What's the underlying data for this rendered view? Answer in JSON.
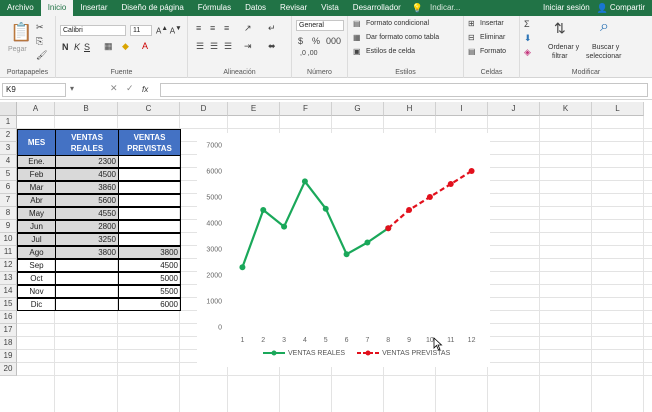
{
  "ribbon": {
    "tabs": [
      "Archivo",
      "Inicio",
      "Insertar",
      "Diseño de página",
      "Fórmulas",
      "Datos",
      "Revisar",
      "Vista",
      "Desarrollador"
    ],
    "active_tab": "Inicio",
    "tell_me": "Indicar...",
    "signin": "Iniciar sesión",
    "share": "Compartir",
    "paste": "Pegar",
    "font_name": "Calibri",
    "font_size": "11",
    "number_format": "General",
    "cond_format": "Formato condicional",
    "table_format": "Dar formato como tabla",
    "cell_styles": "Estilos de celda",
    "insert": "Insertar",
    "delete": "Eliminar",
    "format": "Formato",
    "sort_filter": [
      "Ordenar y",
      "filtrar"
    ],
    "find_select": [
      "Buscar y",
      "seleccionar"
    ],
    "groups": [
      "Portapapeles",
      "Fuente",
      "Alineación",
      "Número",
      "Estilos",
      "Celdas",
      "Modificar"
    ],
    "font_buttons": [
      "N",
      "K",
      "S"
    ]
  },
  "formula_bar": {
    "name_box": "K9",
    "fx": "fx",
    "value": ""
  },
  "columns": [
    "A",
    "B",
    "C",
    "D",
    "E",
    "F",
    "G",
    "H",
    "I",
    "J",
    "K",
    "L"
  ],
  "rows": [
    "1",
    "2",
    "3",
    "4",
    "5",
    "6",
    "7",
    "8",
    "9",
    "10",
    "11",
    "12",
    "13",
    "14",
    "15",
    "16",
    "17",
    "18",
    "19",
    "20"
  ],
  "table": {
    "headers": [
      "MES",
      "VENTAS REALES",
      "VENTAS PREVISTAS"
    ],
    "rows": [
      [
        "Ene.",
        "2300",
        ""
      ],
      [
        "Feb",
        "4500",
        ""
      ],
      [
        "Mar",
        "3860",
        ""
      ],
      [
        "Abr",
        "5600",
        ""
      ],
      [
        "May",
        "4550",
        ""
      ],
      [
        "Jun",
        "2800",
        ""
      ],
      [
        "Jul",
        "3250",
        ""
      ],
      [
        "Ago",
        "3800",
        "3800"
      ],
      [
        "Sep",
        "",
        "4500"
      ],
      [
        "Oct",
        "",
        "5000"
      ],
      [
        "Nov",
        "",
        "5500"
      ],
      [
        "Dic",
        "",
        "6000"
      ]
    ]
  },
  "chart_data": {
    "type": "line",
    "x": [
      1,
      2,
      3,
      4,
      5,
      6,
      7,
      8,
      9,
      10,
      11,
      12
    ],
    "ylim": [
      0,
      7000
    ],
    "yticks": [
      "0",
      "1000",
      "2000",
      "3000",
      "4000",
      "5000",
      "6000",
      "7000"
    ],
    "xticks": [
      "1",
      "2",
      "3",
      "4",
      "5",
      "6",
      "7",
      "8",
      "9",
      "10",
      "11",
      "12"
    ],
    "series": [
      {
        "name": "VENTAS REALES",
        "color": "#1aa85a",
        "style": "solid",
        "values": [
          2300,
          4500,
          3860,
          5600,
          4550,
          2800,
          3250,
          3800,
          null,
          null,
          null,
          null
        ]
      },
      {
        "name": "VENTAS PREVISTAS",
        "color": "#e2101c",
        "style": "dashed",
        "values": [
          null,
          null,
          null,
          null,
          null,
          null,
          null,
          3800,
          4500,
          5000,
          5500,
          6000
        ]
      }
    ],
    "legend": "bottom",
    "grid": false
  }
}
